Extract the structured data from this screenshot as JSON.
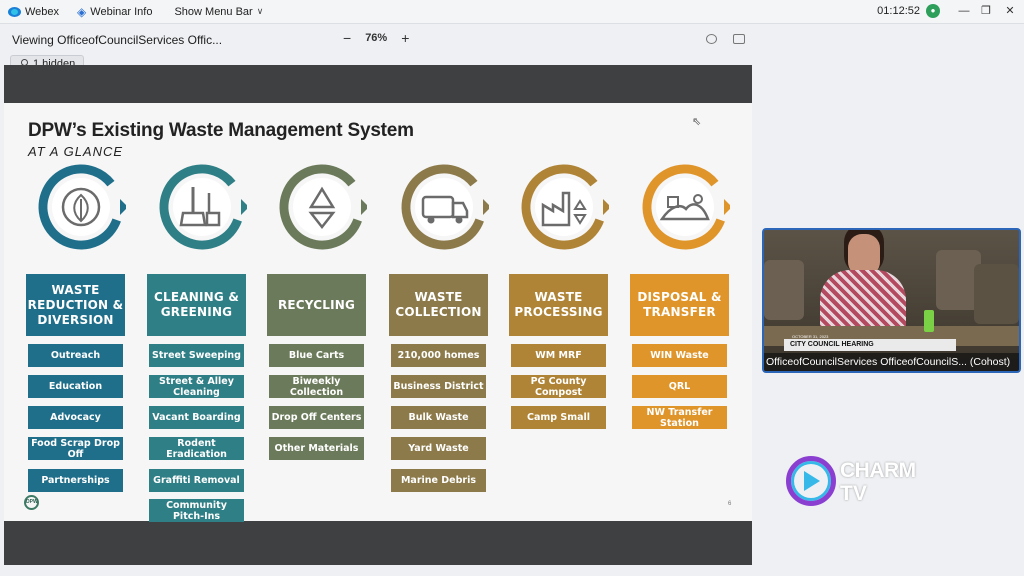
{
  "topbar": {
    "app_name": "Webex",
    "webinar_info": "Webinar Info",
    "menu_toggle": "Show Menu Bar",
    "timer": "01:12:52"
  },
  "viewbar": {
    "viewing_label": "Viewing OfficeofCouncilServices Offic...",
    "zoom_out": "−",
    "zoom_level": "76%",
    "zoom_in": "+"
  },
  "hidden_participants": "1 hidden",
  "slide": {
    "title": "DPW’s Existing Waste Management System",
    "subtitle": "AT A GLANCE",
    "logo_text": "DPW",
    "page_number": "6",
    "columns": [
      {
        "heading": "WASTE REDUCTION & DIVERSION",
        "color": "#1f6f8b",
        "icon": "leaf-recycle-icon",
        "items": [
          "Outreach",
          "Education",
          "Advocacy",
          "Food Scrap Drop Off",
          "Partnerships"
        ]
      },
      {
        "heading": "CLEANING & GREENING",
        "color": "#2f7f86",
        "icon": "broom-dustpan-icon",
        "items": [
          "Street Sweeping",
          "Street & Alley Cleaning",
          "Vacant Boarding",
          "Rodent Eradication",
          "Graffiti Removal",
          "Community Pitch-Ins"
        ]
      },
      {
        "heading": "RECYCLING",
        "color": "#6b7a5a",
        "icon": "recycle-icon",
        "items": [
          "Blue Carts",
          "Biweekly Collection",
          "Drop Off Centers",
          "Other Materials"
        ]
      },
      {
        "heading": "WASTE COLLECTION",
        "color": "#8c7a4a",
        "icon": "garbage-truck-icon",
        "items": [
          "210,000 homes",
          "Business District",
          "Bulk Waste",
          "Yard Waste",
          "Marine Debris"
        ]
      },
      {
        "heading": "WASTE PROCESSING",
        "color": "#b08436",
        "icon": "factory-icon",
        "items": [
          "WM MRF",
          "PG County Compost",
          "Camp Small"
        ]
      },
      {
        "heading": "DISPOSAL & TRANSFER",
        "color": "#e0952a",
        "icon": "landfill-icon",
        "items": [
          "WIN Waste",
          "QRL",
          "NW Transfer Station"
        ]
      }
    ]
  },
  "webcam": {
    "banner_date": "OCTOBER 31, 2023",
    "banner_title": "CITY COUNCIL HEARING",
    "participant_label": "OfficeofCouncilServices OfficeofCouncilS... (Cohost)"
  },
  "brand": {
    "line1": "CHARM",
    "line2": "TV"
  }
}
